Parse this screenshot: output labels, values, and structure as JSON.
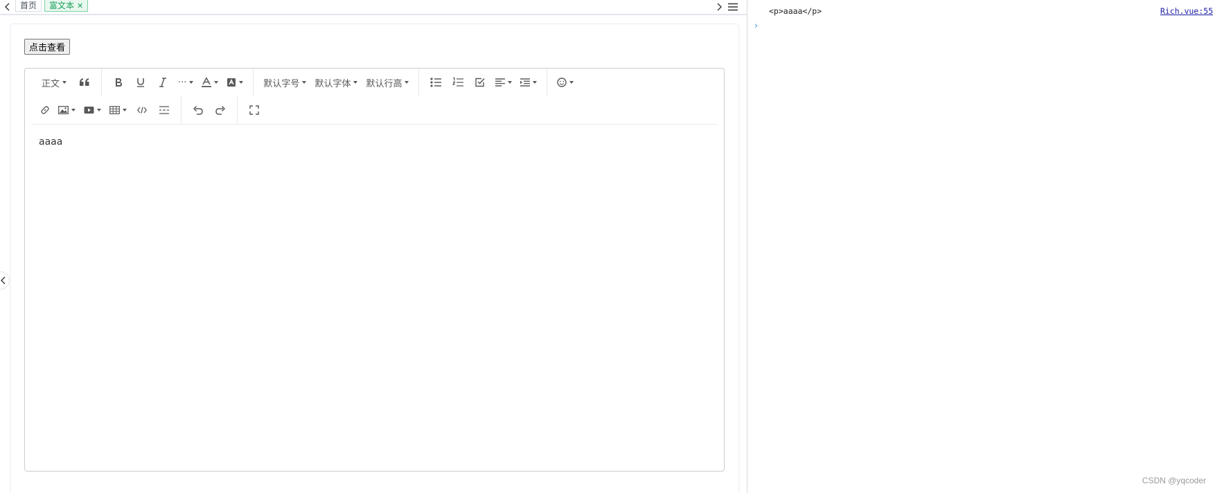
{
  "tabs": {
    "home": "首页",
    "active": "富文本",
    "close_glyph": "✕"
  },
  "page": {
    "view_button": "点击查看"
  },
  "toolbar": {
    "paragraph": "正文",
    "font_size": "默认字号",
    "font_family": "默认字体",
    "line_height": "默认行高",
    "more": "···"
  },
  "editor": {
    "content": "aaaa"
  },
  "console": {
    "log_line": "<p>aaaa</p>",
    "source_link": "Rich.vue:55",
    "prompt": "›"
  },
  "watermark": "CSDN @yqcoder"
}
